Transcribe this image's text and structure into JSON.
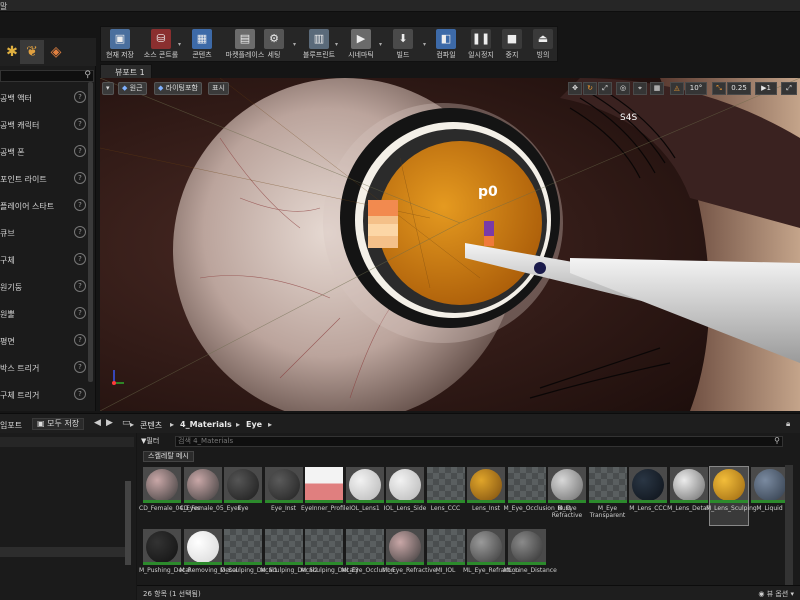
{
  "menubar": {
    "label": "말"
  },
  "toolbar": {
    "buttons": [
      {
        "id": "save",
        "label": "현재 저장",
        "icon": "save-icon",
        "color": "#4a6f9e"
      },
      {
        "id": "source",
        "label": "소스 콘트롤",
        "icon": "source-control-icon",
        "color": "#8a2f2f"
      },
      {
        "id": "content",
        "label": "콘텐츠",
        "icon": "content-browser-icon",
        "color": "#3d6aa8"
      },
      {
        "id": "marketplace",
        "label": "마켓플레이스",
        "icon": "marketplace-icon",
        "color": "#6b6b6b"
      },
      {
        "id": "settings",
        "label": "세팅",
        "icon": "settings-gear-icon",
        "color": "#555555"
      },
      {
        "id": "blueprint",
        "label": "블루프린트",
        "icon": "blueprint-icon",
        "color": "#5a6a7a"
      },
      {
        "id": "cinematics",
        "label": "시네마틱",
        "icon": "cinematics-clapper-icon",
        "color": "#6a6a6a"
      },
      {
        "id": "build",
        "label": "빌드",
        "icon": "build-icon",
        "color": "#4a4a4a"
      },
      {
        "id": "compile",
        "label": "컴파일",
        "icon": "compile-icon",
        "color": "#3d6aa8"
      },
      {
        "id": "pause",
        "label": "일시정지",
        "icon": "pause-icon",
        "color": "#3a3a3a"
      },
      {
        "id": "stop",
        "label": "중지",
        "icon": "stop-icon",
        "color": "#3a3a3a"
      },
      {
        "id": "eject",
        "label": "빙의",
        "icon": "possess-icon",
        "color": "#3a3a3a"
      }
    ]
  },
  "left_panel": {
    "items": [
      "공백 액터",
      "공백 캐릭터",
      "공백 폰",
      "포인트 라이트",
      "플레이어 스타트",
      "큐브",
      "구체",
      "원기둥",
      "원뿔",
      "평면",
      "박스 트리거",
      "구체 트리거"
    ]
  },
  "viewport": {
    "tab_label": "뷰포트 1",
    "controls": {
      "perspective": "원근",
      "lit": "라이팅포함",
      "show": "표시"
    },
    "snap_angle": "10°",
    "scale": "0.25",
    "camera_speed": "1",
    "overlay_labels": {
      "p0": "p0",
      "s4s": "S4S"
    }
  },
  "content_browser": {
    "import_label": "임포트",
    "save_all_label": "모두 저장",
    "breadcrumb": [
      "콘텐츠",
      "4_Materials",
      "Eye"
    ],
    "filter_label": "필터",
    "search_placeholder": "검색 4_Materials",
    "collection_tag": "스켈레탈 메시",
    "assets": [
      {
        "label": "CD_Female_04_Eyes",
        "thumb": "sphere",
        "c1": "#c9a7a7",
        "c2": "#3a3a3a"
      },
      {
        "label": "CD_Female_05_Eyes",
        "thumb": "sphere",
        "c1": "#c9a7a7",
        "c2": "#3a3a3a"
      },
      {
        "label": "Eye",
        "thumb": "sphere",
        "c1": "#555",
        "c2": "#1a1a1a"
      },
      {
        "label": "Eye_Inst",
        "thumb": "sphere",
        "c1": "#5a5a5a",
        "c2": "#202020"
      },
      {
        "label": "EyeInner_Profile",
        "thumb": "profile",
        "c1": "#f3f3f3",
        "c2": "#e07f7f"
      },
      {
        "label": "IOL_Lens1",
        "thumb": "sphere",
        "c1": "#f2f2f2",
        "c2": "#b5b5b5"
      },
      {
        "label": "IOL_Lens_Side",
        "thumb": "sphere",
        "c1": "#f2f2f2",
        "c2": "#b5b5b5"
      },
      {
        "label": "Lens_CCC",
        "thumb": "checker"
      },
      {
        "label": "Lens_Inst",
        "thumb": "sphere",
        "c1": "#e0a52a",
        "c2": "#7a4c10"
      },
      {
        "label": "M_Eye_Occlusion_Bust",
        "thumb": "checker"
      },
      {
        "label": "M_Eye Refractive",
        "thumb": "sphere",
        "c1": "#d8d8d8",
        "c2": "#6a6a6a"
      },
      {
        "label": "M_Eye Transparent",
        "thumb": "checker"
      },
      {
        "label": "M_Lens_CCC",
        "thumb": "sphere",
        "c1": "#2a3644",
        "c2": "#0c1118"
      },
      {
        "label": "M_Lens_Detail",
        "thumb": "sphere",
        "c1": "#ececec",
        "c2": "#6a6a6a"
      },
      {
        "label": "M_Lens_Sculping",
        "thumb": "sphere",
        "c1": "#f2bd3a",
        "c2": "#9a6610",
        "selected": true
      },
      {
        "label": "M_Liquid",
        "thumb": "sphere",
        "c1": "#7a8aa0",
        "c2": "#2f3a48"
      },
      {
        "label": "M_Pushing_Decal",
        "thumb": "sphere",
        "c1": "#333",
        "c2": "#111"
      },
      {
        "label": "M_Removing_Decal",
        "thumb": "sphere",
        "c1": "#ffffff",
        "c2": "#d6d6d6"
      },
      {
        "label": "M_Sculping_Decal1",
        "thumb": "checker"
      },
      {
        "label": "M_Sculping_Decal2",
        "thumb": "checker"
      },
      {
        "label": "M_Sculping_Decal3",
        "thumb": "checker"
      },
      {
        "label": "MI_Eye_Occlusion_",
        "thumb": "checker"
      },
      {
        "label": "MI_Eye_Refractive_",
        "thumb": "sphere",
        "c1": "#c9a7a7",
        "c2": "#3a3a3a"
      },
      {
        "label": "MI_IOL",
        "thumb": "checker"
      },
      {
        "label": "ML_Eye_Refraction",
        "thumb": "sphere",
        "c1": "#9a9a9a",
        "c2": "#3a3a3a"
      },
      {
        "label": "ML_Line_Distance",
        "thumb": "sphere",
        "c1": "#8a8a8a",
        "c2": "#2f2f2f"
      }
    ],
    "status_count": "26 항목 (1 선택됨)",
    "view_options": "뷰 옵션"
  }
}
